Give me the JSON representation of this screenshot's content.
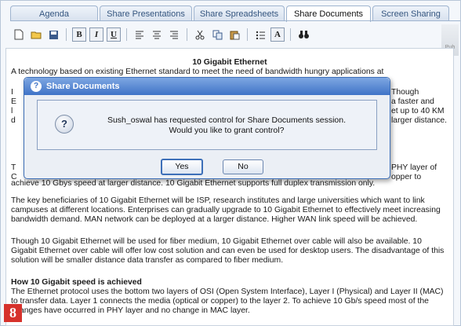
{
  "tabs": [
    "Agenda",
    "Share Presentations",
    "Share Spreadsheets",
    "Share Documents",
    "Screen Sharing"
  ],
  "active_tab": "Share Documents",
  "toolbar": {
    "bold": "B",
    "italic": "I",
    "underline": "U",
    "font": "A",
    "side_label": "Pub"
  },
  "document": {
    "title": "10 Gigabit Ethernet",
    "intro": "A technology based on existing Ethernet standard to meet the need of bandwidth hungry applications at",
    "p1_line1_head": "I",
    "p1_line1_tail": "Though",
    "p1_line2_head": "E",
    "p1_line2_tail": "a faster and",
    "p1_line3_head": "l",
    "p1_line3_tail": "et up to 40 KM",
    "p1_line4_head": "d",
    "p1_line4_tail": "larger distance.",
    "p2_line1_head": "T",
    "p2_line1_tail": "PHY layer of",
    "p2_line2_head": "C",
    "p2_line2_tail": "opper to",
    "p2_line3": "achieve 10 Gbys speed at larger distance. 10 Gigabit Ethernet supports full duplex transmission only.",
    "p3": "The key beneficiaries of 10 Gigabit Ethernet will be ISP, research institutes and large universities which want to link campuses at different locations. Enterprises can gradually upgrade to 10 Gigabit Ethernet to effectively meet increasing bandwidth demand. MAN network can be deployed at a larger distance. Higher WAN link speed will be achieved.",
    "p4": "Though 10 Gigabit Ethernet will be used for fiber medium, 10 Gigabit Ethernet over cable will also be available. 10 Gigabit Ethernet over cable will offer low cost solution and can even be used for desktop users. The disadvantage of this solution will be smaller distance data transfer as compared to fiber medium.",
    "h2": "How 10 Gigabit speed is achieved",
    "p5": "The Ethernet protocol uses the bottom two layers of OSI (Open System Interface), Layer I (Physical) and Layer II (MAC) to transfer data. Layer 1 connects the media (optical or copper) to the layer 2. To achieve 10 Gb/s speed most of the changes have occurred in PHY layer and no change in MAC layer."
  },
  "dialog": {
    "title": "Share Documents",
    "line1": "Sush_oswal has requested control for Share Documents session.",
    "line2": "Would you like to grant control?",
    "yes": "Yes",
    "no": "No"
  },
  "badge": "8"
}
